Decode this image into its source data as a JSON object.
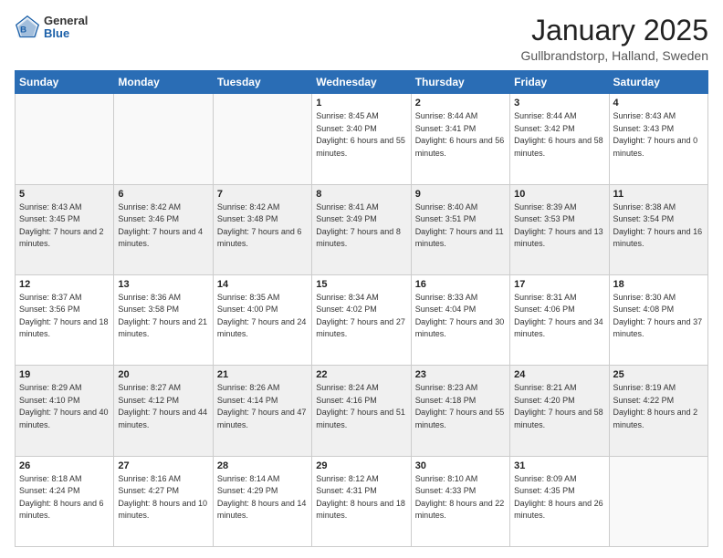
{
  "logo": {
    "general": "General",
    "blue": "Blue"
  },
  "header": {
    "title": "January 2025",
    "location": "Gullbrandstorp, Halland, Sweden"
  },
  "weekdays": [
    "Sunday",
    "Monday",
    "Tuesday",
    "Wednesday",
    "Thursday",
    "Friday",
    "Saturday"
  ],
  "weeks": [
    [
      {
        "day": "",
        "sunrise": "",
        "sunset": "",
        "daylight": ""
      },
      {
        "day": "",
        "sunrise": "",
        "sunset": "",
        "daylight": ""
      },
      {
        "day": "",
        "sunrise": "",
        "sunset": "",
        "daylight": ""
      },
      {
        "day": "1",
        "sunrise": "Sunrise: 8:45 AM",
        "sunset": "Sunset: 3:40 PM",
        "daylight": "Daylight: 6 hours and 55 minutes."
      },
      {
        "day": "2",
        "sunrise": "Sunrise: 8:44 AM",
        "sunset": "Sunset: 3:41 PM",
        "daylight": "Daylight: 6 hours and 56 minutes."
      },
      {
        "day": "3",
        "sunrise": "Sunrise: 8:44 AM",
        "sunset": "Sunset: 3:42 PM",
        "daylight": "Daylight: 6 hours and 58 minutes."
      },
      {
        "day": "4",
        "sunrise": "Sunrise: 8:43 AM",
        "sunset": "Sunset: 3:43 PM",
        "daylight": "Daylight: 7 hours and 0 minutes."
      }
    ],
    [
      {
        "day": "5",
        "sunrise": "Sunrise: 8:43 AM",
        "sunset": "Sunset: 3:45 PM",
        "daylight": "Daylight: 7 hours and 2 minutes."
      },
      {
        "day": "6",
        "sunrise": "Sunrise: 8:42 AM",
        "sunset": "Sunset: 3:46 PM",
        "daylight": "Daylight: 7 hours and 4 minutes."
      },
      {
        "day": "7",
        "sunrise": "Sunrise: 8:42 AM",
        "sunset": "Sunset: 3:48 PM",
        "daylight": "Daylight: 7 hours and 6 minutes."
      },
      {
        "day": "8",
        "sunrise": "Sunrise: 8:41 AM",
        "sunset": "Sunset: 3:49 PM",
        "daylight": "Daylight: 7 hours and 8 minutes."
      },
      {
        "day": "9",
        "sunrise": "Sunrise: 8:40 AM",
        "sunset": "Sunset: 3:51 PM",
        "daylight": "Daylight: 7 hours and 11 minutes."
      },
      {
        "day": "10",
        "sunrise": "Sunrise: 8:39 AM",
        "sunset": "Sunset: 3:53 PM",
        "daylight": "Daylight: 7 hours and 13 minutes."
      },
      {
        "day": "11",
        "sunrise": "Sunrise: 8:38 AM",
        "sunset": "Sunset: 3:54 PM",
        "daylight": "Daylight: 7 hours and 16 minutes."
      }
    ],
    [
      {
        "day": "12",
        "sunrise": "Sunrise: 8:37 AM",
        "sunset": "Sunset: 3:56 PM",
        "daylight": "Daylight: 7 hours and 18 minutes."
      },
      {
        "day": "13",
        "sunrise": "Sunrise: 8:36 AM",
        "sunset": "Sunset: 3:58 PM",
        "daylight": "Daylight: 7 hours and 21 minutes."
      },
      {
        "day": "14",
        "sunrise": "Sunrise: 8:35 AM",
        "sunset": "Sunset: 4:00 PM",
        "daylight": "Daylight: 7 hours and 24 minutes."
      },
      {
        "day": "15",
        "sunrise": "Sunrise: 8:34 AM",
        "sunset": "Sunset: 4:02 PM",
        "daylight": "Daylight: 7 hours and 27 minutes."
      },
      {
        "day": "16",
        "sunrise": "Sunrise: 8:33 AM",
        "sunset": "Sunset: 4:04 PM",
        "daylight": "Daylight: 7 hours and 30 minutes."
      },
      {
        "day": "17",
        "sunrise": "Sunrise: 8:31 AM",
        "sunset": "Sunset: 4:06 PM",
        "daylight": "Daylight: 7 hours and 34 minutes."
      },
      {
        "day": "18",
        "sunrise": "Sunrise: 8:30 AM",
        "sunset": "Sunset: 4:08 PM",
        "daylight": "Daylight: 7 hours and 37 minutes."
      }
    ],
    [
      {
        "day": "19",
        "sunrise": "Sunrise: 8:29 AM",
        "sunset": "Sunset: 4:10 PM",
        "daylight": "Daylight: 7 hours and 40 minutes."
      },
      {
        "day": "20",
        "sunrise": "Sunrise: 8:27 AM",
        "sunset": "Sunset: 4:12 PM",
        "daylight": "Daylight: 7 hours and 44 minutes."
      },
      {
        "day": "21",
        "sunrise": "Sunrise: 8:26 AM",
        "sunset": "Sunset: 4:14 PM",
        "daylight": "Daylight: 7 hours and 47 minutes."
      },
      {
        "day": "22",
        "sunrise": "Sunrise: 8:24 AM",
        "sunset": "Sunset: 4:16 PM",
        "daylight": "Daylight: 7 hours and 51 minutes."
      },
      {
        "day": "23",
        "sunrise": "Sunrise: 8:23 AM",
        "sunset": "Sunset: 4:18 PM",
        "daylight": "Daylight: 7 hours and 55 minutes."
      },
      {
        "day": "24",
        "sunrise": "Sunrise: 8:21 AM",
        "sunset": "Sunset: 4:20 PM",
        "daylight": "Daylight: 7 hours and 58 minutes."
      },
      {
        "day": "25",
        "sunrise": "Sunrise: 8:19 AM",
        "sunset": "Sunset: 4:22 PM",
        "daylight": "Daylight: 8 hours and 2 minutes."
      }
    ],
    [
      {
        "day": "26",
        "sunrise": "Sunrise: 8:18 AM",
        "sunset": "Sunset: 4:24 PM",
        "daylight": "Daylight: 8 hours and 6 minutes."
      },
      {
        "day": "27",
        "sunrise": "Sunrise: 8:16 AM",
        "sunset": "Sunset: 4:27 PM",
        "daylight": "Daylight: 8 hours and 10 minutes."
      },
      {
        "day": "28",
        "sunrise": "Sunrise: 8:14 AM",
        "sunset": "Sunset: 4:29 PM",
        "daylight": "Daylight: 8 hours and 14 minutes."
      },
      {
        "day": "29",
        "sunrise": "Sunrise: 8:12 AM",
        "sunset": "Sunset: 4:31 PM",
        "daylight": "Daylight: 8 hours and 18 minutes."
      },
      {
        "day": "30",
        "sunrise": "Sunrise: 8:10 AM",
        "sunset": "Sunset: 4:33 PM",
        "daylight": "Daylight: 8 hours and 22 minutes."
      },
      {
        "day": "31",
        "sunrise": "Sunrise: 8:09 AM",
        "sunset": "Sunset: 4:35 PM",
        "daylight": "Daylight: 8 hours and 26 minutes."
      },
      {
        "day": "",
        "sunrise": "",
        "sunset": "",
        "daylight": ""
      }
    ]
  ]
}
